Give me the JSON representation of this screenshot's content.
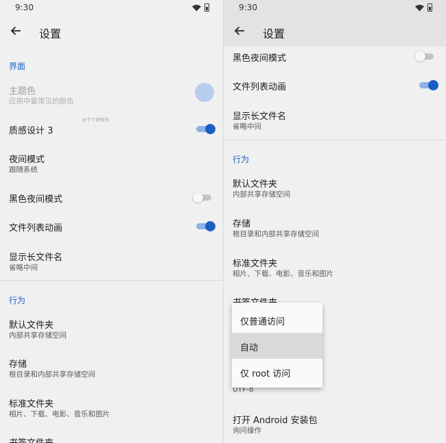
{
  "status": {
    "time": "9:30"
  },
  "appbar": {
    "title": "设置"
  },
  "colors": {
    "accent": "#1e63c6",
    "switch_on": "#1c5fc4",
    "swatch": "#b7cdef"
  },
  "left": {
    "section_ui": "界面",
    "theme_color": {
      "title": "主题色",
      "subtitle": "应用中最常见的颜色"
    },
    "material3": {
      "title": "质感设计 3"
    },
    "night_mode": {
      "title": "夜间模式",
      "subtitle": "跟随系统"
    },
    "black_night": {
      "title": "黑色夜间模式"
    },
    "list_anim": {
      "title": "文件列表动画"
    },
    "long_name": {
      "title": "显示长文件名",
      "subtitle": "省略中间"
    },
    "section_behavior": "行为",
    "default_dir": {
      "title": "默认文件夹",
      "subtitle": "内部共享存储空间"
    },
    "storage": {
      "title": "存储",
      "subtitle": "根目录和内部共享存储空间"
    },
    "standard_dirs": {
      "title": "标准文件夹",
      "subtitle": "相片、下载、电影、音乐和图片"
    },
    "bookmarks": {
      "title": "书签文件夹"
    },
    "watermark": "@下个好软件"
  },
  "right": {
    "black_night": {
      "title": "黑色夜间模式"
    },
    "list_anim": {
      "title": "文件列表动画"
    },
    "long_name": {
      "title": "显示长文件名",
      "subtitle": "省略中间"
    },
    "section_behavior": "行为",
    "default_dir": {
      "title": "默认文件夹",
      "subtitle": "内部共享存储空间"
    },
    "storage": {
      "title": "存储",
      "subtitle": "根目录和内部共享存储空间"
    },
    "standard_dirs": {
      "title": "标准文件夹",
      "subtitle": "相片、下载、电影、音乐和图片"
    },
    "bookmarks": {
      "title": "书签文件夹"
    },
    "encoding_sub": "UTF-8",
    "open_apk": {
      "title": "打开 Android 安装包",
      "subtitle": "询问操作"
    }
  },
  "menu": {
    "items": [
      "仅普通访问",
      "自动",
      "仅 root 访问"
    ],
    "selected_label": "自动"
  }
}
